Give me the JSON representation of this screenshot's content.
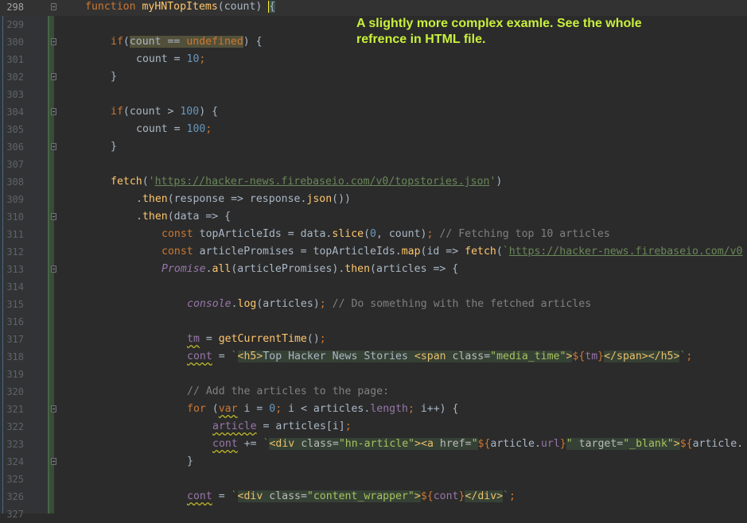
{
  "annotation": {
    "text": "A slightly more complex examle. See the whole refrence in HTML file."
  },
  "lines": [
    {
      "n": "298"
    },
    {
      "n": "299"
    },
    {
      "n": "300"
    },
    {
      "n": "301"
    },
    {
      "n": "302"
    },
    {
      "n": "303"
    },
    {
      "n": "304"
    },
    {
      "n": "305"
    },
    {
      "n": "306"
    },
    {
      "n": "307"
    },
    {
      "n": "308"
    },
    {
      "n": "309"
    },
    {
      "n": "310"
    },
    {
      "n": "311"
    },
    {
      "n": "312"
    },
    {
      "n": "313"
    },
    {
      "n": "314"
    },
    {
      "n": "315"
    },
    {
      "n": "316"
    },
    {
      "n": "317"
    },
    {
      "n": "318"
    },
    {
      "n": "319"
    },
    {
      "n": "320"
    },
    {
      "n": "321"
    },
    {
      "n": "322"
    },
    {
      "n": "323"
    },
    {
      "n": "324"
    },
    {
      "n": "325"
    },
    {
      "n": "326"
    },
    {
      "n": "327"
    }
  ],
  "code": {
    "l298": {
      "kw": "function",
      "name": "myHNTopItems",
      "rest": "(count) ",
      "brace": "{"
    },
    "l300": {
      "kw": "if",
      "open": "(",
      "cond": "count == ",
      "undef": "undefined",
      "close": ") {"
    },
    "l301": {
      "lhs": "count = ",
      "num": "10",
      "semi": ";"
    },
    "l302": {
      "text": "}"
    },
    "l304": {
      "kw": "if",
      "rest": "(count > ",
      "num": "100",
      "close": ") {"
    },
    "l305": {
      "lhs": "count = ",
      "num": "100",
      "semi": ";"
    },
    "l306": {
      "text": "}"
    },
    "l308": {
      "fn": "fetch",
      "open": "(",
      "q1": "'",
      "url": "https://hacker-news.firebaseio.com/v0/topstories.json",
      "q2": "'",
      "close": ")"
    },
    "l309": {
      "dot": ".",
      "fn": "then",
      "rest": "(response => response.",
      "fn2": "json",
      "end": "())"
    },
    "l310": {
      "dot": ".",
      "fn": "then",
      "rest": "(data => {"
    },
    "l311": {
      "kw": "const",
      "lhs": " topArticleIds = data.",
      "fn": "slice",
      "open": "(",
      "num": "0",
      "rest": ", count)",
      "semi": ";",
      "cmt": " // Fetching top 10 articles"
    },
    "l312": {
      "kw": "const",
      "lhs": " articlePromises = topArticleIds.",
      "fn": "map",
      "rest": "(id => ",
      "fn2": "fetch",
      "open": "(",
      "tick": "`",
      "url": "https://hacker-news.firebaseio.com/v0"
    },
    "l313": {
      "cls": "Promise",
      "dot": ".",
      "fn": "all",
      "rest": "(articlePromises).",
      "fn2": "then",
      "end": "(articles => {"
    },
    "l315": {
      "obj": "console",
      "dot": ".",
      "fn": "log",
      "rest": "(articles)",
      "semi": ";",
      "cmt": " // Do something with the fetched articles"
    },
    "l317": {
      "var": "tm",
      "eq": " = ",
      "fn": "getCurrentTime",
      "end": "()",
      "semi": ";"
    },
    "l318": {
      "var": "cont",
      "eq": " = ",
      "tick": "`",
      "t1": "<h5>",
      "txt": "Top Hacker News Stories ",
      "t2": "<span ",
      "a1": "class=",
      "v1": "\"media_time\"",
      "t3": ">",
      "dl": "${",
      "iv": "tm",
      "dr": "}",
      "t4": "</span></h5>",
      "tick2": "`",
      "semi": ";"
    },
    "l320": {
      "cmt": "// Add the articles to the page:"
    },
    "l321": {
      "kw": "for",
      "open": " (",
      "kw2": "var",
      "rest": " i = ",
      "num": "0",
      "semi": ";",
      "rest2": " i < articles.",
      "prop": "length",
      "semi2": ";",
      "rest3": " i++) {"
    },
    "l322": {
      "var": "article",
      "eq": " = articles[i]",
      "semi": ";"
    },
    "l323": {
      "var": "cont",
      "eq": " += ",
      "tick": "`",
      "t1": "<div ",
      "a1": "class=",
      "v1": "\"hn-article\"",
      "t2": "><a ",
      "a2": "href=",
      "q": "\"",
      "dl": "${",
      "iv": "article.",
      "prop": "url",
      "dr": "}",
      "q2": "\"",
      "a3": " target=",
      "v3": "\"_blank\"",
      "t3": ">",
      "dl2": "${",
      "iv2": "article."
    },
    "l324": {
      "text": "}"
    },
    "l326": {
      "var": "cont",
      "eq": " = ",
      "tick": "`",
      "t1": "<div ",
      "a1": "class=",
      "v1": "\"content_wrapper\"",
      "t2": ">",
      "dl": "${",
      "iv": "cont",
      "dr": "}",
      "t3": "</div>",
      "tick2": "`",
      "semi": ";"
    }
  }
}
